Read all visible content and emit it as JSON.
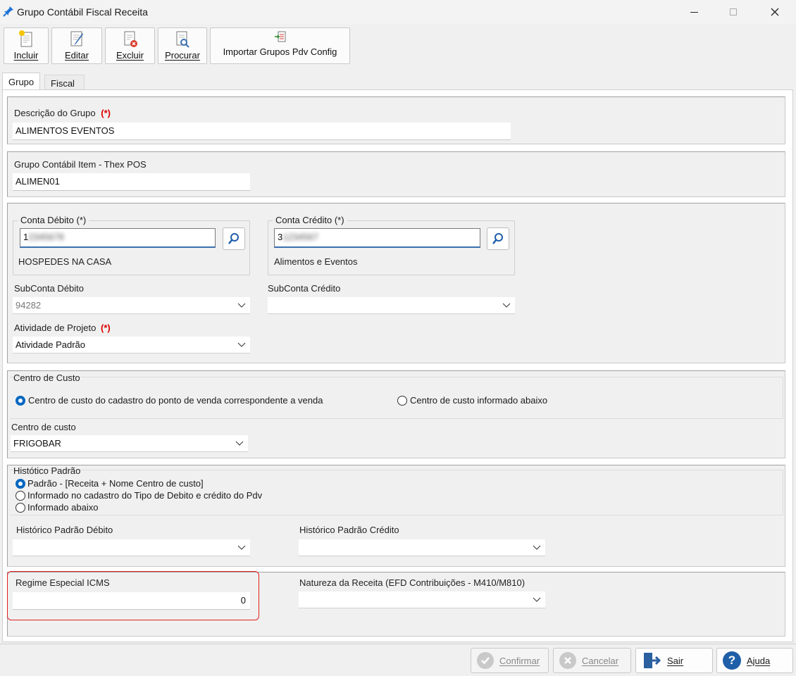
{
  "window": {
    "title": "Grupo Contábil Fiscal Receita"
  },
  "toolbar": {
    "incluir": "Incluir",
    "editar": "Editar",
    "excluir": "Excluir",
    "procurar": "Procurar",
    "importar": "Importar Grupos Pdv Config"
  },
  "tabs": [
    "Grupo",
    "Fiscal"
  ],
  "grupo": {
    "descricao_label": "Descrição do Grupo",
    "required_mark": "(*)",
    "descricao_value": "ALIMENTOS EVENTOS",
    "item_label": "Grupo Contábil Item - Thex POS",
    "item_value": "ALIMEN01"
  },
  "contas": {
    "debito_title": "Conta Débito (*)",
    "debito_value": "1",
    "debito_desc": "HOSPEDES NA CASA",
    "credito_title": "Conta Crédito (*)",
    "credito_value": "3",
    "credito_desc": "Alimentos e Eventos",
    "subconta_debito_label": "SubConta Débito",
    "subconta_debito_value": "94282",
    "subconta_credito_label": "SubConta Crédito",
    "subconta_credito_value": "",
    "atividade_label": "Atividade de Projeto",
    "atividade_value": "Atividade Padrão"
  },
  "centro": {
    "title": "Centro de Custo",
    "option1": "Centro de custo do cadastro do ponto de venda correspondente a venda",
    "option2": "Centro de custo informado abaixo",
    "selected": "option1",
    "combo_label": "Centro de custo",
    "combo_value": "FRIGOBAR"
  },
  "historico": {
    "title": "Histótico Padrão",
    "option1": "Padrão - [Receita + Nome Centro de custo]",
    "option2": "Informado no cadastro do Tipo de Debito e crédito do Pdv",
    "option3": "Informado abaixo",
    "selected": "option1",
    "debito_label": "Histórico Padrão Débito",
    "debito_value": "",
    "credito_label": "Histórico Padrão Crédito",
    "credito_value": ""
  },
  "regime": {
    "label": "Regime Especial ICMS",
    "value": "0",
    "natureza_label": "Natureza da Receita (EFD Contribuições - M410/M810)",
    "natureza_value": ""
  },
  "footer": {
    "confirmar": "Confirmar",
    "cancelar": "Cancelar",
    "sair": "Sair",
    "ajuda": "Ajuda"
  },
  "colors": {
    "accent": "#0067c0",
    "highlight": "#e02020",
    "required": "#dd0000"
  }
}
